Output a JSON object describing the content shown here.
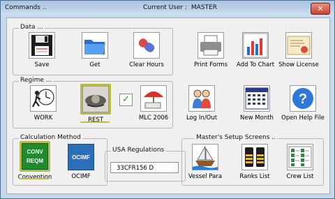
{
  "window": {
    "title": "Commands ..",
    "current_user_label": "Current User :",
    "current_user_value": "MASTER",
    "close_glyph": "✕"
  },
  "groups": {
    "data": "Data ...",
    "regime": "Regime ...",
    "calc": "Calculation Method",
    "usa": "USA Regulations",
    "setup": "Master's Setup Screens  .."
  },
  "data_buttons": {
    "save": "Save",
    "get": "Get",
    "clear": "Clear Hours",
    "print": "Print Forms",
    "chart": "Add To Chart",
    "license": "Show License"
  },
  "regime_buttons": {
    "work": "WORK",
    "rest": "REST",
    "mlc": "MLC 2006",
    "login": "Log In/Out",
    "newmonth": "New Month",
    "help": "Open Help File"
  },
  "calc": {
    "convention": "Convention",
    "ocimf": "OCIMF",
    "conv_icon_text_1": "CONV",
    "conv_icon_text_2": "REQM",
    "ocimf_icon_text": "OCIMF"
  },
  "usa_field_value": "33CFR156 D",
  "setup": {
    "vessel": "Vessel Para",
    "ranks": "Ranks List",
    "crew": "Crew List"
  },
  "check_glyph": "✓"
}
